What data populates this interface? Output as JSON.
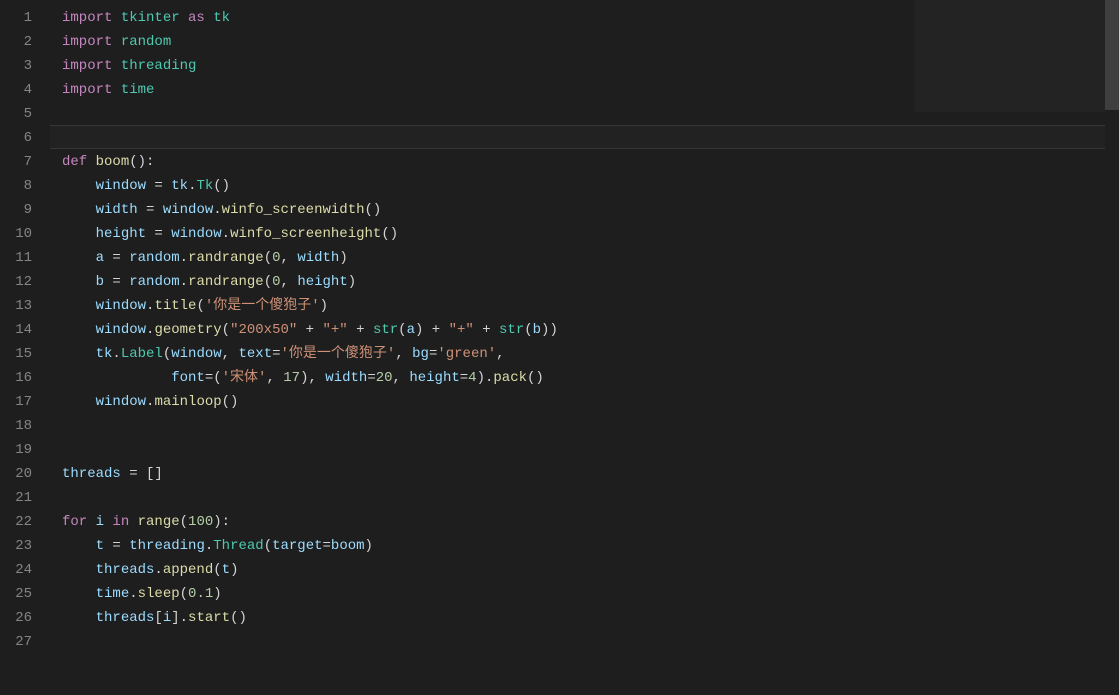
{
  "editor": {
    "current_line_index": 5,
    "line_count": 27,
    "lines": [
      [
        {
          "t": "import ",
          "c": "kw"
        },
        {
          "t": "tkinter ",
          "c": "mod"
        },
        {
          "t": "as ",
          "c": "kw"
        },
        {
          "t": "tk",
          "c": "mod"
        }
      ],
      [
        {
          "t": "import ",
          "c": "kw"
        },
        {
          "t": "random",
          "c": "mod"
        }
      ],
      [
        {
          "t": "import ",
          "c": "kw"
        },
        {
          "t": "threading",
          "c": "mod"
        }
      ],
      [
        {
          "t": "import ",
          "c": "kw"
        },
        {
          "t": "time",
          "c": "mod"
        }
      ],
      [
        {
          "t": "",
          "c": "pun"
        }
      ],
      [
        {
          "t": "",
          "c": "pun"
        }
      ],
      [
        {
          "t": "def ",
          "c": "kw"
        },
        {
          "t": "boom",
          "c": "fn"
        },
        {
          "t": "():",
          "c": "pun"
        }
      ],
      [
        {
          "t": "    ",
          "c": "pun"
        },
        {
          "t": "window",
          "c": "var"
        },
        {
          "t": " = ",
          "c": "pun"
        },
        {
          "t": "tk",
          "c": "obj"
        },
        {
          "t": ".",
          "c": "pun"
        },
        {
          "t": "Tk",
          "c": "mod"
        },
        {
          "t": "()",
          "c": "pun"
        }
      ],
      [
        {
          "t": "    ",
          "c": "pun"
        },
        {
          "t": "width",
          "c": "var"
        },
        {
          "t": " = ",
          "c": "pun"
        },
        {
          "t": "window",
          "c": "obj"
        },
        {
          "t": ".",
          "c": "pun"
        },
        {
          "t": "winfo_screenwidth",
          "c": "fn"
        },
        {
          "t": "()",
          "c": "pun"
        }
      ],
      [
        {
          "t": "    ",
          "c": "pun"
        },
        {
          "t": "height",
          "c": "var"
        },
        {
          "t": " = ",
          "c": "pun"
        },
        {
          "t": "window",
          "c": "obj"
        },
        {
          "t": ".",
          "c": "pun"
        },
        {
          "t": "winfo_screenheight",
          "c": "fn"
        },
        {
          "t": "()",
          "c": "pun"
        }
      ],
      [
        {
          "t": "    ",
          "c": "pun"
        },
        {
          "t": "a",
          "c": "var"
        },
        {
          "t": " = ",
          "c": "pun"
        },
        {
          "t": "random",
          "c": "obj"
        },
        {
          "t": ".",
          "c": "pun"
        },
        {
          "t": "randrange",
          "c": "fn"
        },
        {
          "t": "(",
          "c": "pun"
        },
        {
          "t": "0",
          "c": "num"
        },
        {
          "t": ", ",
          "c": "pun"
        },
        {
          "t": "width",
          "c": "var"
        },
        {
          "t": ")",
          "c": "pun"
        }
      ],
      [
        {
          "t": "    ",
          "c": "pun"
        },
        {
          "t": "b",
          "c": "var"
        },
        {
          "t": " = ",
          "c": "pun"
        },
        {
          "t": "random",
          "c": "obj"
        },
        {
          "t": ".",
          "c": "pun"
        },
        {
          "t": "randrange",
          "c": "fn"
        },
        {
          "t": "(",
          "c": "pun"
        },
        {
          "t": "0",
          "c": "num"
        },
        {
          "t": ", ",
          "c": "pun"
        },
        {
          "t": "height",
          "c": "var"
        },
        {
          "t": ")",
          "c": "pun"
        }
      ],
      [
        {
          "t": "    ",
          "c": "pun"
        },
        {
          "t": "window",
          "c": "obj"
        },
        {
          "t": ".",
          "c": "pun"
        },
        {
          "t": "title",
          "c": "fn"
        },
        {
          "t": "(",
          "c": "pun"
        },
        {
          "t": "'你是一个傻狍子'",
          "c": "str"
        },
        {
          "t": ")",
          "c": "pun"
        }
      ],
      [
        {
          "t": "    ",
          "c": "pun"
        },
        {
          "t": "window",
          "c": "obj"
        },
        {
          "t": ".",
          "c": "pun"
        },
        {
          "t": "geometry",
          "c": "fn"
        },
        {
          "t": "(",
          "c": "pun"
        },
        {
          "t": "\"200x50\"",
          "c": "str"
        },
        {
          "t": " + ",
          "c": "pun"
        },
        {
          "t": "\"+\"",
          "c": "str"
        },
        {
          "t": " + ",
          "c": "pun"
        },
        {
          "t": "str",
          "c": "mod"
        },
        {
          "t": "(",
          "c": "pun"
        },
        {
          "t": "a",
          "c": "var"
        },
        {
          "t": ") + ",
          "c": "pun"
        },
        {
          "t": "\"+\"",
          "c": "str"
        },
        {
          "t": " + ",
          "c": "pun"
        },
        {
          "t": "str",
          "c": "mod"
        },
        {
          "t": "(",
          "c": "pun"
        },
        {
          "t": "b",
          "c": "var"
        },
        {
          "t": "))",
          "c": "pun"
        }
      ],
      [
        {
          "t": "    ",
          "c": "pun"
        },
        {
          "t": "tk",
          "c": "obj"
        },
        {
          "t": ".",
          "c": "pun"
        },
        {
          "t": "Label",
          "c": "mod"
        },
        {
          "t": "(",
          "c": "pun"
        },
        {
          "t": "window",
          "c": "var"
        },
        {
          "t": ", ",
          "c": "pun"
        },
        {
          "t": "text",
          "c": "var"
        },
        {
          "t": "=",
          "c": "pun"
        },
        {
          "t": "'你是一个傻狍子'",
          "c": "str"
        },
        {
          "t": ", ",
          "c": "pun"
        },
        {
          "t": "bg",
          "c": "var"
        },
        {
          "t": "=",
          "c": "pun"
        },
        {
          "t": "'green'",
          "c": "str"
        },
        {
          "t": ",",
          "c": "pun"
        }
      ],
      [
        {
          "t": "             ",
          "c": "pun"
        },
        {
          "t": "font",
          "c": "var"
        },
        {
          "t": "=(",
          "c": "pun"
        },
        {
          "t": "'宋体'",
          "c": "str"
        },
        {
          "t": ", ",
          "c": "pun"
        },
        {
          "t": "17",
          "c": "num"
        },
        {
          "t": "), ",
          "c": "pun"
        },
        {
          "t": "width",
          "c": "var"
        },
        {
          "t": "=",
          "c": "pun"
        },
        {
          "t": "20",
          "c": "num"
        },
        {
          "t": ", ",
          "c": "pun"
        },
        {
          "t": "height",
          "c": "var"
        },
        {
          "t": "=",
          "c": "pun"
        },
        {
          "t": "4",
          "c": "num"
        },
        {
          "t": ").",
          "c": "pun"
        },
        {
          "t": "pack",
          "c": "fn"
        },
        {
          "t": "()",
          "c": "pun"
        }
      ],
      [
        {
          "t": "    ",
          "c": "pun"
        },
        {
          "t": "window",
          "c": "obj"
        },
        {
          "t": ".",
          "c": "pun"
        },
        {
          "t": "mainloop",
          "c": "fn"
        },
        {
          "t": "()",
          "c": "pun"
        }
      ],
      [
        {
          "t": "",
          "c": "pun"
        }
      ],
      [
        {
          "t": "",
          "c": "pun"
        }
      ],
      [
        {
          "t": "threads",
          "c": "var"
        },
        {
          "t": " = []",
          "c": "pun"
        }
      ],
      [
        {
          "t": "",
          "c": "pun"
        }
      ],
      [
        {
          "t": "for ",
          "c": "kw"
        },
        {
          "t": "i",
          "c": "var"
        },
        {
          "t": " in ",
          "c": "kw"
        },
        {
          "t": "range",
          "c": "fn"
        },
        {
          "t": "(",
          "c": "pun"
        },
        {
          "t": "100",
          "c": "num"
        },
        {
          "t": "):",
          "c": "pun"
        }
      ],
      [
        {
          "t": "    ",
          "c": "pun"
        },
        {
          "t": "t",
          "c": "var"
        },
        {
          "t": " = ",
          "c": "pun"
        },
        {
          "t": "threading",
          "c": "obj"
        },
        {
          "t": ".",
          "c": "pun"
        },
        {
          "t": "Thread",
          "c": "mod"
        },
        {
          "t": "(",
          "c": "pun"
        },
        {
          "t": "target",
          "c": "var"
        },
        {
          "t": "=",
          "c": "pun"
        },
        {
          "t": "boom",
          "c": "var"
        },
        {
          "t": ")",
          "c": "pun"
        }
      ],
      [
        {
          "t": "    ",
          "c": "pun"
        },
        {
          "t": "threads",
          "c": "obj"
        },
        {
          "t": ".",
          "c": "pun"
        },
        {
          "t": "append",
          "c": "fn"
        },
        {
          "t": "(",
          "c": "pun"
        },
        {
          "t": "t",
          "c": "var"
        },
        {
          "t": ")",
          "c": "pun"
        }
      ],
      [
        {
          "t": "    ",
          "c": "pun"
        },
        {
          "t": "time",
          "c": "obj"
        },
        {
          "t": ".",
          "c": "pun"
        },
        {
          "t": "sleep",
          "c": "fn"
        },
        {
          "t": "(",
          "c": "pun"
        },
        {
          "t": "0.1",
          "c": "num"
        },
        {
          "t": ")",
          "c": "pun"
        }
      ],
      [
        {
          "t": "    ",
          "c": "pun"
        },
        {
          "t": "threads",
          "c": "obj"
        },
        {
          "t": "[",
          "c": "pun"
        },
        {
          "t": "i",
          "c": "var"
        },
        {
          "t": "].",
          "c": "pun"
        },
        {
          "t": "start",
          "c": "fn"
        },
        {
          "t": "()",
          "c": "pun"
        }
      ],
      [
        {
          "t": "",
          "c": "pun"
        }
      ]
    ]
  }
}
